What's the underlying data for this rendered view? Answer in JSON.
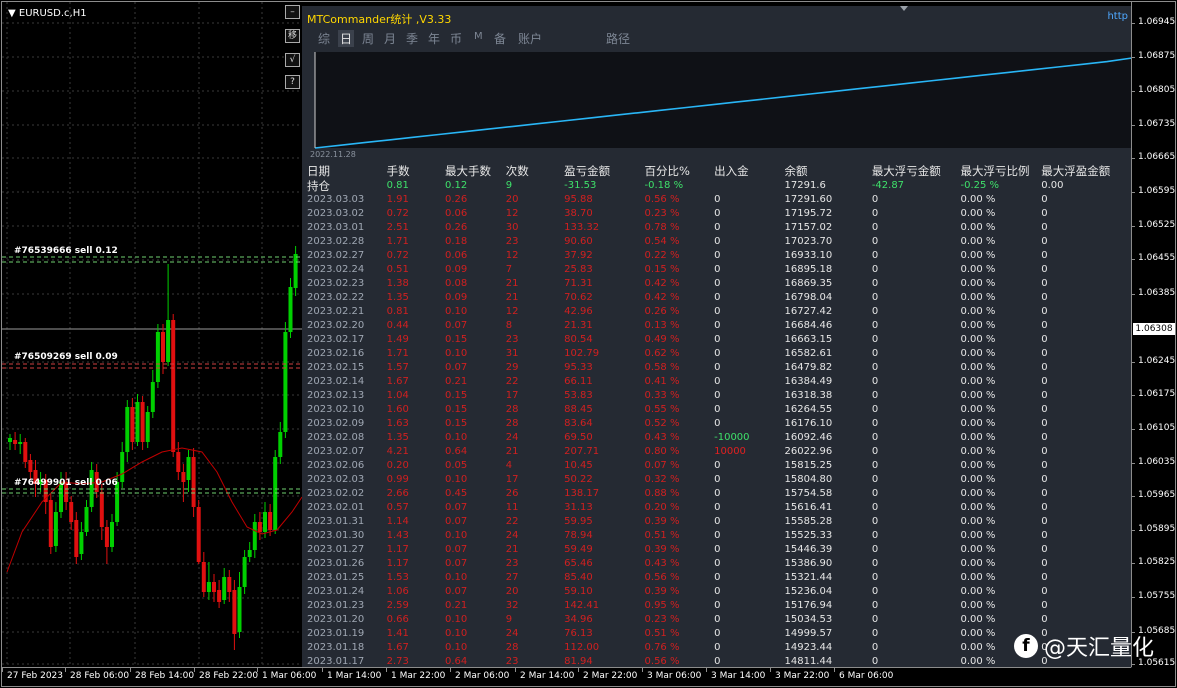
{
  "chart": {
    "symbol": "EURUSD.c,H1",
    "side_buttons": [
      "–",
      "移",
      "√",
      "?"
    ],
    "orders": [
      "#76539666 sell 0.12",
      "#76509269 sell 0.09",
      "#76499901 sell 0.06"
    ],
    "current_price": "1.06308",
    "price_ticks": [
      "1.06945",
      "1.06875",
      "1.06805",
      "1.06735",
      "1.06665",
      "1.06595",
      "1.06525",
      "1.06455",
      "1.06385",
      "1.06245",
      "1.06175",
      "1.06105",
      "1.06035",
      "1.05965",
      "1.05895",
      "1.05825",
      "1.05755",
      "1.05685",
      "1.05615"
    ],
    "time_ticks": [
      "27 Feb 2023",
      "28 Feb 06:00",
      "28 Feb 14:00",
      "28 Feb 22:00",
      "1 Mar 06:00",
      "1 Mar 14:00",
      "1 Mar 22:00",
      "2 Mar 06:00",
      "2 Mar 14:00",
      "2 Mar 22:00",
      "3 Mar 06:00",
      "3 Mar 14:00",
      "3 Mar 22:00",
      "6 Mar 06:00"
    ],
    "colors": {
      "bull": "#00d000",
      "bear": "#e01010",
      "ma": "#c00000",
      "order_line": "#6fd06f",
      "tp_line": "#d04040"
    }
  },
  "panel": {
    "title": "MTCommander统计 ,V3.33",
    "link": "http",
    "tabs": [
      "综",
      "日",
      "周",
      "月",
      "季",
      "年",
      "币",
      "M",
      "备",
      "账户",
      "路径"
    ],
    "active_tab": "日",
    "equity_start_date": "2022.11.28",
    "equity_colors": {
      "line": "#29b6f6",
      "area": "#0f1116"
    },
    "equity_series": [
      0.0,
      0.03,
      0.06,
      0.09,
      0.12,
      0.15,
      0.18,
      0.21,
      0.24,
      0.27,
      0.3,
      0.33,
      0.36,
      0.39,
      0.42,
      0.45,
      0.48,
      0.51,
      0.54,
      0.57,
      0.6,
      0.63,
      0.66,
      0.69,
      0.72,
      0.75,
      0.78,
      0.81,
      0.84,
      0.87,
      0.9,
      0.93,
      0.96,
      1.0
    ],
    "headers": [
      "日期",
      "手数",
      "最大手数",
      "次数",
      "盈亏金额",
      "百分比%",
      "出入金",
      "余额",
      "最大浮亏金额",
      "最大浮亏比例",
      "最大浮盈金额"
    ],
    "hold_row": [
      "持仓",
      "0.81",
      "0.12",
      "9",
      "-31.53",
      "-0.18 %",
      "",
      "17291.6",
      "-42.87",
      "-0.25 %",
      "0.00"
    ],
    "rows": [
      [
        "2023.03.03",
        "1.91",
        "0.26",
        "20",
        "95.88",
        "0.56 %",
        "0",
        "17291.60",
        "0",
        "0.00 %",
        "0"
      ],
      [
        "2023.03.02",
        "0.72",
        "0.06",
        "12",
        "38.70",
        "0.23 %",
        "0",
        "17195.72",
        "0",
        "0.00 %",
        "0"
      ],
      [
        "2023.03.01",
        "2.51",
        "0.26",
        "30",
        "133.32",
        "0.78 %",
        "0",
        "17157.02",
        "0",
        "0.00 %",
        "0"
      ],
      [
        "2023.02.28",
        "1.71",
        "0.18",
        "23",
        "90.60",
        "0.54 %",
        "0",
        "17023.70",
        "0",
        "0.00 %",
        "0"
      ],
      [
        "2023.02.27",
        "0.72",
        "0.06",
        "12",
        "37.92",
        "0.22 %",
        "0",
        "16933.10",
        "0",
        "0.00 %",
        "0"
      ],
      [
        "2023.02.24",
        "0.51",
        "0.09",
        "7",
        "25.83",
        "0.15 %",
        "0",
        "16895.18",
        "0",
        "0.00 %",
        "0"
      ],
      [
        "2023.02.23",
        "1.38",
        "0.08",
        "21",
        "71.31",
        "0.42 %",
        "0",
        "16869.35",
        "0",
        "0.00 %",
        "0"
      ],
      [
        "2023.02.22",
        "1.35",
        "0.09",
        "21",
        "70.62",
        "0.42 %",
        "0",
        "16798.04",
        "0",
        "0.00 %",
        "0"
      ],
      [
        "2023.02.21",
        "0.81",
        "0.10",
        "12",
        "42.96",
        "0.26 %",
        "0",
        "16727.42",
        "0",
        "0.00 %",
        "0"
      ],
      [
        "2023.02.20",
        "0.44",
        "0.07",
        "8",
        "21.31",
        "0.13 %",
        "0",
        "16684.46",
        "0",
        "0.00 %",
        "0"
      ],
      [
        "2023.02.17",
        "1.49",
        "0.15",
        "23",
        "80.54",
        "0.49 %",
        "0",
        "16663.15",
        "0",
        "0.00 %",
        "0"
      ],
      [
        "2023.02.16",
        "1.71",
        "0.10",
        "31",
        "102.79",
        "0.62 %",
        "0",
        "16582.61",
        "0",
        "0.00 %",
        "0"
      ],
      [
        "2023.02.15",
        "1.57",
        "0.07",
        "29",
        "95.33",
        "0.58 %",
        "0",
        "16479.82",
        "0",
        "0.00 %",
        "0"
      ],
      [
        "2023.02.14",
        "1.67",
        "0.21",
        "22",
        "66.11",
        "0.41 %",
        "0",
        "16384.49",
        "0",
        "0.00 %",
        "0"
      ],
      [
        "2023.02.13",
        "1.04",
        "0.15",
        "17",
        "53.83",
        "0.33 %",
        "0",
        "16318.38",
        "0",
        "0.00 %",
        "0"
      ],
      [
        "2023.02.10",
        "1.60",
        "0.15",
        "28",
        "88.45",
        "0.55 %",
        "0",
        "16264.55",
        "0",
        "0.00 %",
        "0"
      ],
      [
        "2023.02.09",
        "1.63",
        "0.15",
        "28",
        "83.64",
        "0.52 %",
        "0",
        "16176.10",
        "0",
        "0.00 %",
        "0"
      ],
      [
        "2023.02.08",
        "1.35",
        "0.10",
        "24",
        "69.50",
        "0.43 %",
        "-10000",
        "16092.46",
        "0",
        "0.00 %",
        "0"
      ],
      [
        "2023.02.07",
        "4.21",
        "0.64",
        "21",
        "207.71",
        "0.80 %",
        "10000",
        "26022.96",
        "0",
        "0.00 %",
        "0"
      ],
      [
        "2023.02.06",
        "0.20",
        "0.05",
        "4",
        "10.45",
        "0.07 %",
        "0",
        "15815.25",
        "0",
        "0.00 %",
        "0"
      ],
      [
        "2023.02.03",
        "0.99",
        "0.10",
        "17",
        "50.22",
        "0.32 %",
        "0",
        "15804.80",
        "0",
        "0.00 %",
        "0"
      ],
      [
        "2023.02.02",
        "2.66",
        "0.45",
        "26",
        "138.17",
        "0.88 %",
        "0",
        "15754.58",
        "0",
        "0.00 %",
        "0"
      ],
      [
        "2023.02.01",
        "0.57",
        "0.07",
        "11",
        "31.13",
        "0.20 %",
        "0",
        "15616.41",
        "0",
        "0.00 %",
        "0"
      ],
      [
        "2023.01.31",
        "1.14",
        "0.07",
        "22",
        "59.95",
        "0.39 %",
        "0",
        "15585.28",
        "0",
        "0.00 %",
        "0"
      ],
      [
        "2023.01.30",
        "1.43",
        "0.10",
        "24",
        "78.94",
        "0.51 %",
        "0",
        "15525.33",
        "0",
        "0.00 %",
        "0"
      ],
      [
        "2023.01.27",
        "1.17",
        "0.07",
        "21",
        "59.49",
        "0.39 %",
        "0",
        "15446.39",
        "0",
        "0.00 %",
        "0"
      ],
      [
        "2023.01.26",
        "1.17",
        "0.07",
        "23",
        "65.46",
        "0.43 %",
        "0",
        "15386.90",
        "0",
        "0.00 %",
        "0"
      ],
      [
        "2023.01.25",
        "1.53",
        "0.10",
        "27",
        "85.40",
        "0.56 %",
        "0",
        "15321.44",
        "0",
        "0.00 %",
        "0"
      ],
      [
        "2023.01.24",
        "1.06",
        "0.07",
        "20",
        "59.10",
        "0.39 %",
        "0",
        "15236.04",
        "0",
        "0.00 %",
        "0"
      ],
      [
        "2023.01.23",
        "2.59",
        "0.21",
        "32",
        "142.41",
        "0.95 %",
        "0",
        "15176.94",
        "0",
        "0.00 %",
        "0"
      ],
      [
        "2023.01.20",
        "0.66",
        "0.10",
        "9",
        "34.96",
        "0.23 %",
        "0",
        "15034.53",
        "0",
        "0.00 %",
        "0"
      ],
      [
        "2023.01.19",
        "1.41",
        "0.10",
        "24",
        "76.13",
        "0.51 %",
        "0",
        "14999.57",
        "0",
        "0.00 %",
        "0"
      ],
      [
        "2023.01.18",
        "1.67",
        "0.10",
        "28",
        "112.00",
        "0.76 %",
        "0",
        "14923.44",
        "0",
        "0.00 %",
        "0"
      ],
      [
        "2023.01.17",
        "2.73",
        "0.64",
        "23",
        "81.94",
        "0.56 %",
        "0",
        "14811.44",
        "0",
        "0.00 %",
        "0"
      ]
    ]
  },
  "watermark": {
    "logo": "f",
    "text": "@天汇量化"
  }
}
